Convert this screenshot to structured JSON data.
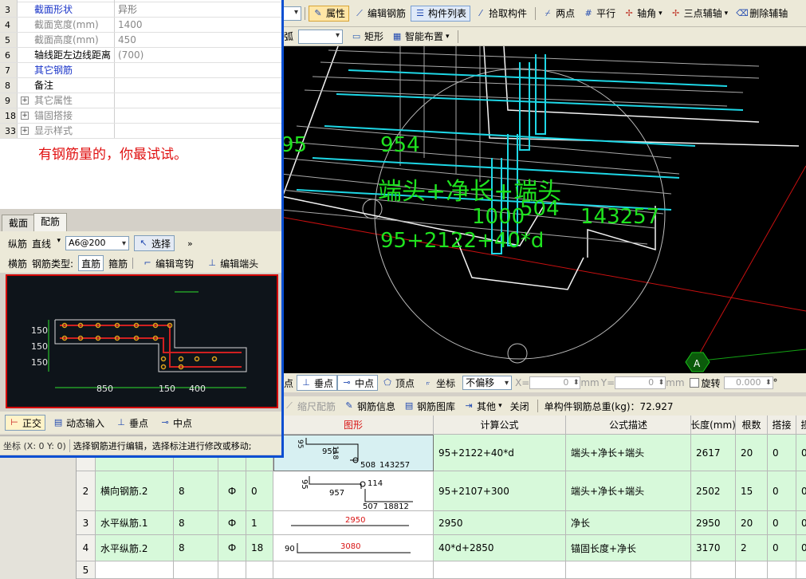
{
  "toolbar1": {
    "properties": "属性",
    "edit_rebar": "编辑钢筋",
    "component_list": "构件列表",
    "pick_component": "拾取构件",
    "two_points": "两点",
    "parallel": "平行",
    "axis_angle": "轴角",
    "three_point_aux": "三点辅轴",
    "delete_aux": "删除辅轴"
  },
  "toolbar2": {
    "arc": "弧",
    "rectangle": "矩形",
    "smart_layout": "智能布置"
  },
  "viewport": {
    "labels": [
      "95",
      "954",
      "端头+净长+端头",
      "1000",
      "504",
      "143257",
      "95+2122+40*d"
    ],
    "axis_marker": "A"
  },
  "snapbar": {
    "perpendicular": "垂点",
    "midpoint": "中点",
    "vertex": "顶点",
    "coordinate": "坐标",
    "offset_mode": "不偏移",
    "x_label": "X=",
    "x_value": "0",
    "y_label": "Y=",
    "y_value": "0",
    "unit": "mm",
    "rotate_label": "旋转",
    "rotate_value": "0.000",
    "degree": "°"
  },
  "rebar_bar": {
    "scale_rebar": "缩尺配筋",
    "rebar_info": "钢筋信息",
    "rebar_library": "钢筋图库",
    "other": "其他",
    "close": "关闭",
    "total_weight": "单构件钢筋总重(kg)：72.927"
  },
  "grid": {
    "headers": [
      "",
      "",
      "",
      "",
      "",
      "图形",
      "计算公式",
      "公式描述",
      "长度(mm)",
      "根数",
      "搭接",
      "损"
    ],
    "rows": [
      {
        "num": "",
        "name": "",
        "dia": "",
        "grade": "",
        "code": "",
        "shape_text": [
          "959",
          "118",
          "508",
          "143257",
          "95"
        ],
        "formula": "95+2122+40*d",
        "desc": "端头+净长+端头",
        "length": "2617",
        "count": "20",
        "lap": "0",
        "loss": "0"
      },
      {
        "num": "2",
        "name": "横向钢筋.2",
        "dia": "8",
        "grade": "Ф",
        "code": "0",
        "shape_text": [
          "957",
          "95",
          "114",
          "507",
          "18812"
        ],
        "formula": "95+2107+300",
        "desc": "端头+净长+端头",
        "length": "2502",
        "count": "15",
        "lap": "0",
        "loss": "0"
      },
      {
        "num": "3",
        "name": "水平纵筋.1",
        "dia": "8",
        "grade": "Ф",
        "code": "1",
        "shape_text": [
          "2950"
        ],
        "formula": "2950",
        "desc": "净长",
        "length": "2950",
        "count": "20",
        "lap": "0",
        "loss": "0"
      },
      {
        "num": "4",
        "name": "水平纵筋.2",
        "dia": "8",
        "grade": "Ф",
        "code": "18",
        "shape_text": [
          "90",
          "3080"
        ],
        "formula": "40*d+2850",
        "desc": "锚固长度+净长",
        "length": "3170",
        "count": "2",
        "lap": "0",
        "loss": "0"
      },
      {
        "num": "5",
        "name": "",
        "dia": "",
        "grade": "",
        "code": "",
        "shape_text": [],
        "formula": "",
        "desc": "",
        "length": "",
        "count": "",
        "lap": "",
        "loss": ""
      }
    ]
  },
  "dialog": {
    "properties": [
      {
        "num": "3",
        "name": "截面形状",
        "value": "异形",
        "style": "blue"
      },
      {
        "num": "4",
        "name": "截面宽度(mm)",
        "value": "1400",
        "style": "gray"
      },
      {
        "num": "5",
        "name": "截面高度(mm)",
        "value": "450",
        "style": "gray"
      },
      {
        "num": "6",
        "name": "轴线距左边线距离",
        "value": "(700)",
        "style": "normal"
      },
      {
        "num": "7",
        "name": "其它钢筋",
        "value": "",
        "style": "blue"
      },
      {
        "num": "8",
        "name": "备注",
        "value": "",
        "style": "normal"
      },
      {
        "num": "9",
        "name": "其它属性",
        "value": "",
        "style": "group"
      },
      {
        "num": "18",
        "name": "锚固搭接",
        "value": "",
        "style": "group"
      },
      {
        "num": "33",
        "name": "显示样式",
        "value": "",
        "style": "group"
      }
    ],
    "annotation": "有钢筋量的，你最试试。",
    "tabs": [
      "截面",
      "配筋"
    ],
    "longitudinal_label": "纵筋",
    "line_type": "直线",
    "rebar_spec": "A6@200",
    "select": "选择",
    "transverse_label": "横筋",
    "rebar_type_label": "钢筋类型:",
    "straight_rebar": "直筋",
    "stirrup": "箍筋",
    "edit_bend": "编辑弯钩",
    "edit_end": "编辑端头",
    "preview": {
      "dims_left": [
        "150",
        "150",
        "150"
      ],
      "dims_bottom": [
        "850",
        "150",
        "400"
      ]
    },
    "ortho": "正交",
    "dynamic_input": "动态输入",
    "perpendicular": "垂点",
    "midpoint": "中点",
    "status_coord": "坐标 (X: 0 Y: 0)",
    "status_hint": "选择钢筋进行编辑，选择标注进行修改或移动;"
  }
}
